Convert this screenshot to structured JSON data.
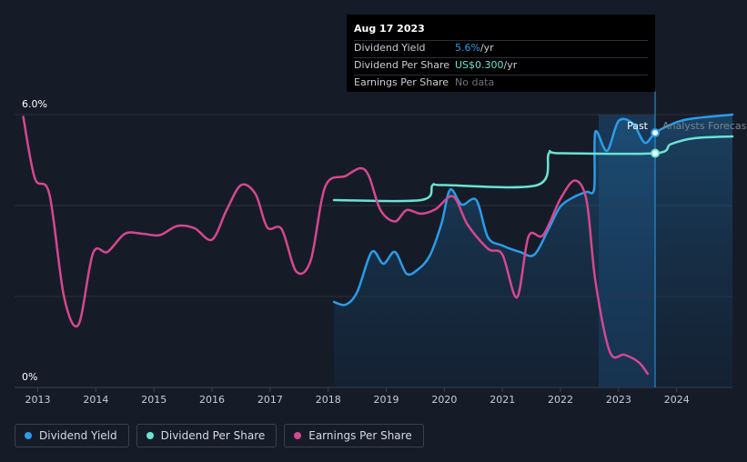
{
  "tooltip": {
    "date": "Aug 17 2023",
    "rows": [
      {
        "label": "Dividend Yield",
        "value": "5.6%",
        "unit": " /yr"
      },
      {
        "label": "Dividend Per Share",
        "value": "US$0.300",
        "unit": " /yr"
      },
      {
        "label": "Earnings Per Share",
        "value": "No data",
        "unit": ""
      }
    ]
  },
  "past_label": "Past",
  "forecast_label": "Analysts Forecasts",
  "legend": [
    {
      "label": "Dividend Yield",
      "color": "#2b9ce8"
    },
    {
      "label": "Dividend Per Share",
      "color": "#6be3d3"
    },
    {
      "label": "Earnings Per Share",
      "color": "#d6478f"
    }
  ],
  "chart_data": {
    "type": "line",
    "y_tick_labels": [
      "6.0%",
      "0%"
    ],
    "ylim": [
      0,
      6.0
    ],
    "xlim": [
      2012.6,
      2024.96
    ],
    "x_ticks": [
      2013,
      2014,
      2015,
      2016,
      2017,
      2018,
      2019,
      2020,
      2021,
      2022,
      2023,
      2024
    ],
    "x_tick_labels": [
      "2013",
      "2014",
      "2015",
      "2016",
      "2017",
      "2018",
      "2019",
      "2020",
      "2021",
      "2022",
      "2023",
      "2024"
    ],
    "grid": true,
    "forecast_start": 2023.63,
    "series": [
      {
        "name": "Dividend Yield",
        "color": "#2b9ce8",
        "area": true,
        "points": [
          [
            2018.1,
            1.88
          ],
          [
            2018.3,
            1.82
          ],
          [
            2018.5,
            2.1
          ],
          [
            2018.75,
            2.98
          ],
          [
            2018.95,
            2.72
          ],
          [
            2019.15,
            2.98
          ],
          [
            2019.35,
            2.5
          ],
          [
            2019.55,
            2.6
          ],
          [
            2019.75,
            2.9
          ],
          [
            2019.95,
            3.6
          ],
          [
            2020.1,
            4.35
          ],
          [
            2020.3,
            4.02
          ],
          [
            2020.55,
            4.12
          ],
          [
            2020.75,
            3.3
          ],
          [
            2021.0,
            3.12
          ],
          [
            2021.3,
            2.98
          ],
          [
            2021.55,
            2.92
          ],
          [
            2021.8,
            3.5
          ],
          [
            2022.0,
            3.98
          ],
          [
            2022.25,
            4.2
          ],
          [
            2022.45,
            4.3
          ],
          [
            2022.58,
            4.38
          ],
          [
            2022.6,
            5.62
          ],
          [
            2022.8,
            5.2
          ],
          [
            2023.0,
            5.86
          ],
          [
            2023.25,
            5.8
          ],
          [
            2023.45,
            5.38
          ],
          [
            2023.63,
            5.6
          ],
          [
            2023.9,
            5.78
          ],
          [
            2024.2,
            5.9
          ],
          [
            2024.96,
            6.0
          ]
        ]
      },
      {
        "name": "Dividend Per Share",
        "color": "#6be3d3",
        "points": [
          [
            2018.1,
            4.12
          ],
          [
            2019.6,
            4.12
          ],
          [
            2019.8,
            4.45
          ],
          [
            2020.0,
            4.45
          ],
          [
            2021.6,
            4.45
          ],
          [
            2021.8,
            5.15
          ],
          [
            2022.0,
            5.15
          ],
          [
            2023.63,
            5.15
          ],
          [
            2023.9,
            5.35
          ],
          [
            2024.3,
            5.48
          ],
          [
            2024.96,
            5.52
          ]
        ]
      },
      {
        "name": "Earnings Per Share",
        "color": "#d6478f",
        "points": [
          [
            2012.75,
            5.95
          ],
          [
            2012.95,
            4.6
          ],
          [
            2013.2,
            4.25
          ],
          [
            2013.45,
            2.0
          ],
          [
            2013.7,
            1.38
          ],
          [
            2013.95,
            2.95
          ],
          [
            2014.2,
            2.98
          ],
          [
            2014.5,
            3.38
          ],
          [
            2014.8,
            3.38
          ],
          [
            2015.1,
            3.35
          ],
          [
            2015.4,
            3.55
          ],
          [
            2015.7,
            3.5
          ],
          [
            2016.0,
            3.25
          ],
          [
            2016.25,
            3.9
          ],
          [
            2016.5,
            4.45
          ],
          [
            2016.75,
            4.25
          ],
          [
            2016.95,
            3.52
          ],
          [
            2017.2,
            3.48
          ],
          [
            2017.45,
            2.55
          ],
          [
            2017.7,
            2.8
          ],
          [
            2017.95,
            4.42
          ],
          [
            2018.3,
            4.65
          ],
          [
            2018.55,
            4.82
          ],
          [
            2018.7,
            4.65
          ],
          [
            2018.9,
            3.9
          ],
          [
            2019.15,
            3.65
          ],
          [
            2019.35,
            3.9
          ],
          [
            2019.6,
            3.82
          ],
          [
            2019.85,
            3.92
          ],
          [
            2020.15,
            4.2
          ],
          [
            2020.4,
            3.58
          ],
          [
            2020.75,
            3.05
          ],
          [
            2021.0,
            2.92
          ],
          [
            2021.25,
            1.98
          ],
          [
            2021.45,
            3.32
          ],
          [
            2021.7,
            3.35
          ],
          [
            2022.0,
            4.15
          ],
          [
            2022.25,
            4.55
          ],
          [
            2022.45,
            4.1
          ],
          [
            2022.6,
            2.35
          ],
          [
            2022.85,
            0.78
          ],
          [
            2023.1,
            0.72
          ],
          [
            2023.35,
            0.55
          ],
          [
            2023.5,
            0.3
          ]
        ]
      }
    ]
  }
}
